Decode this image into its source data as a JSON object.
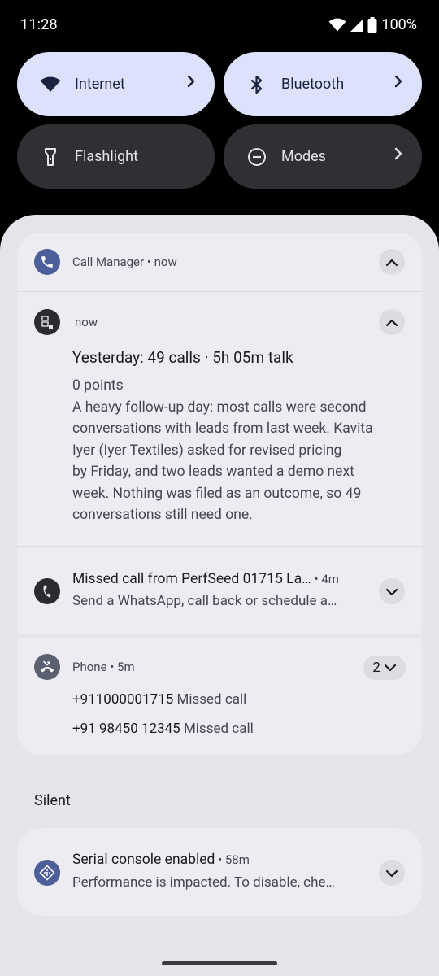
{
  "status_bar": {
    "time": "11:28",
    "battery": "100%",
    "icons": [
      "wifi-icon",
      "cell-signal-icon",
      "battery-icon"
    ]
  },
  "quick_settings": {
    "tiles": [
      {
        "label": "Internet",
        "icon": "wifi-icon",
        "active": true
      },
      {
        "label": "Bluetooth",
        "icon": "bluetooth-icon",
        "active": true
      },
      {
        "label": "Flashlight",
        "icon": "flashlight-icon",
        "active": false
      },
      {
        "label": "Modes",
        "icon": "do-not-disturb-icon",
        "active": false
      }
    ]
  },
  "notifications": {
    "call_manager": {
      "app": "Call Manager",
      "time": "now",
      "summary": {
        "time": "now",
        "title": "Yesterday: 49 calls · 5h 05m talk",
        "points": "0 points",
        "lines": [
          "A heavy follow-up day: most calls were second",
          "conversations with leads from last week. Kavita",
          "Iyer (Iyer Textiles) asked for revised pricing",
          "by Friday, and two leads wanted a demo next",
          "week. Nothing was filed as an outcome, so 49",
          "conversations still need one."
        ]
      },
      "missed": {
        "title": "Missed call from PerfSeed 01715 La…",
        "time": "4m",
        "text": "Send a WhatsApp, call back or schedule a…"
      }
    },
    "phone": {
      "app": "Phone",
      "time": "5m",
      "count": "2",
      "items": [
        {
          "number": "+911000001715",
          "status": "Missed call"
        },
        {
          "number": "+91 98450 12345",
          "status": "Missed call"
        }
      ]
    },
    "silent_header": "Silent",
    "serial": {
      "title": "Serial console enabled",
      "time": "58m",
      "text": "Performance is impacted. To disable, che…"
    }
  },
  "colors": {
    "shade_bg": "#e4e4ea",
    "card_bg": "#ececf2",
    "tile_active": "#dce2fb",
    "tile_inactive": "#2f3033",
    "app_icon_blue": "#4c5f9b"
  }
}
